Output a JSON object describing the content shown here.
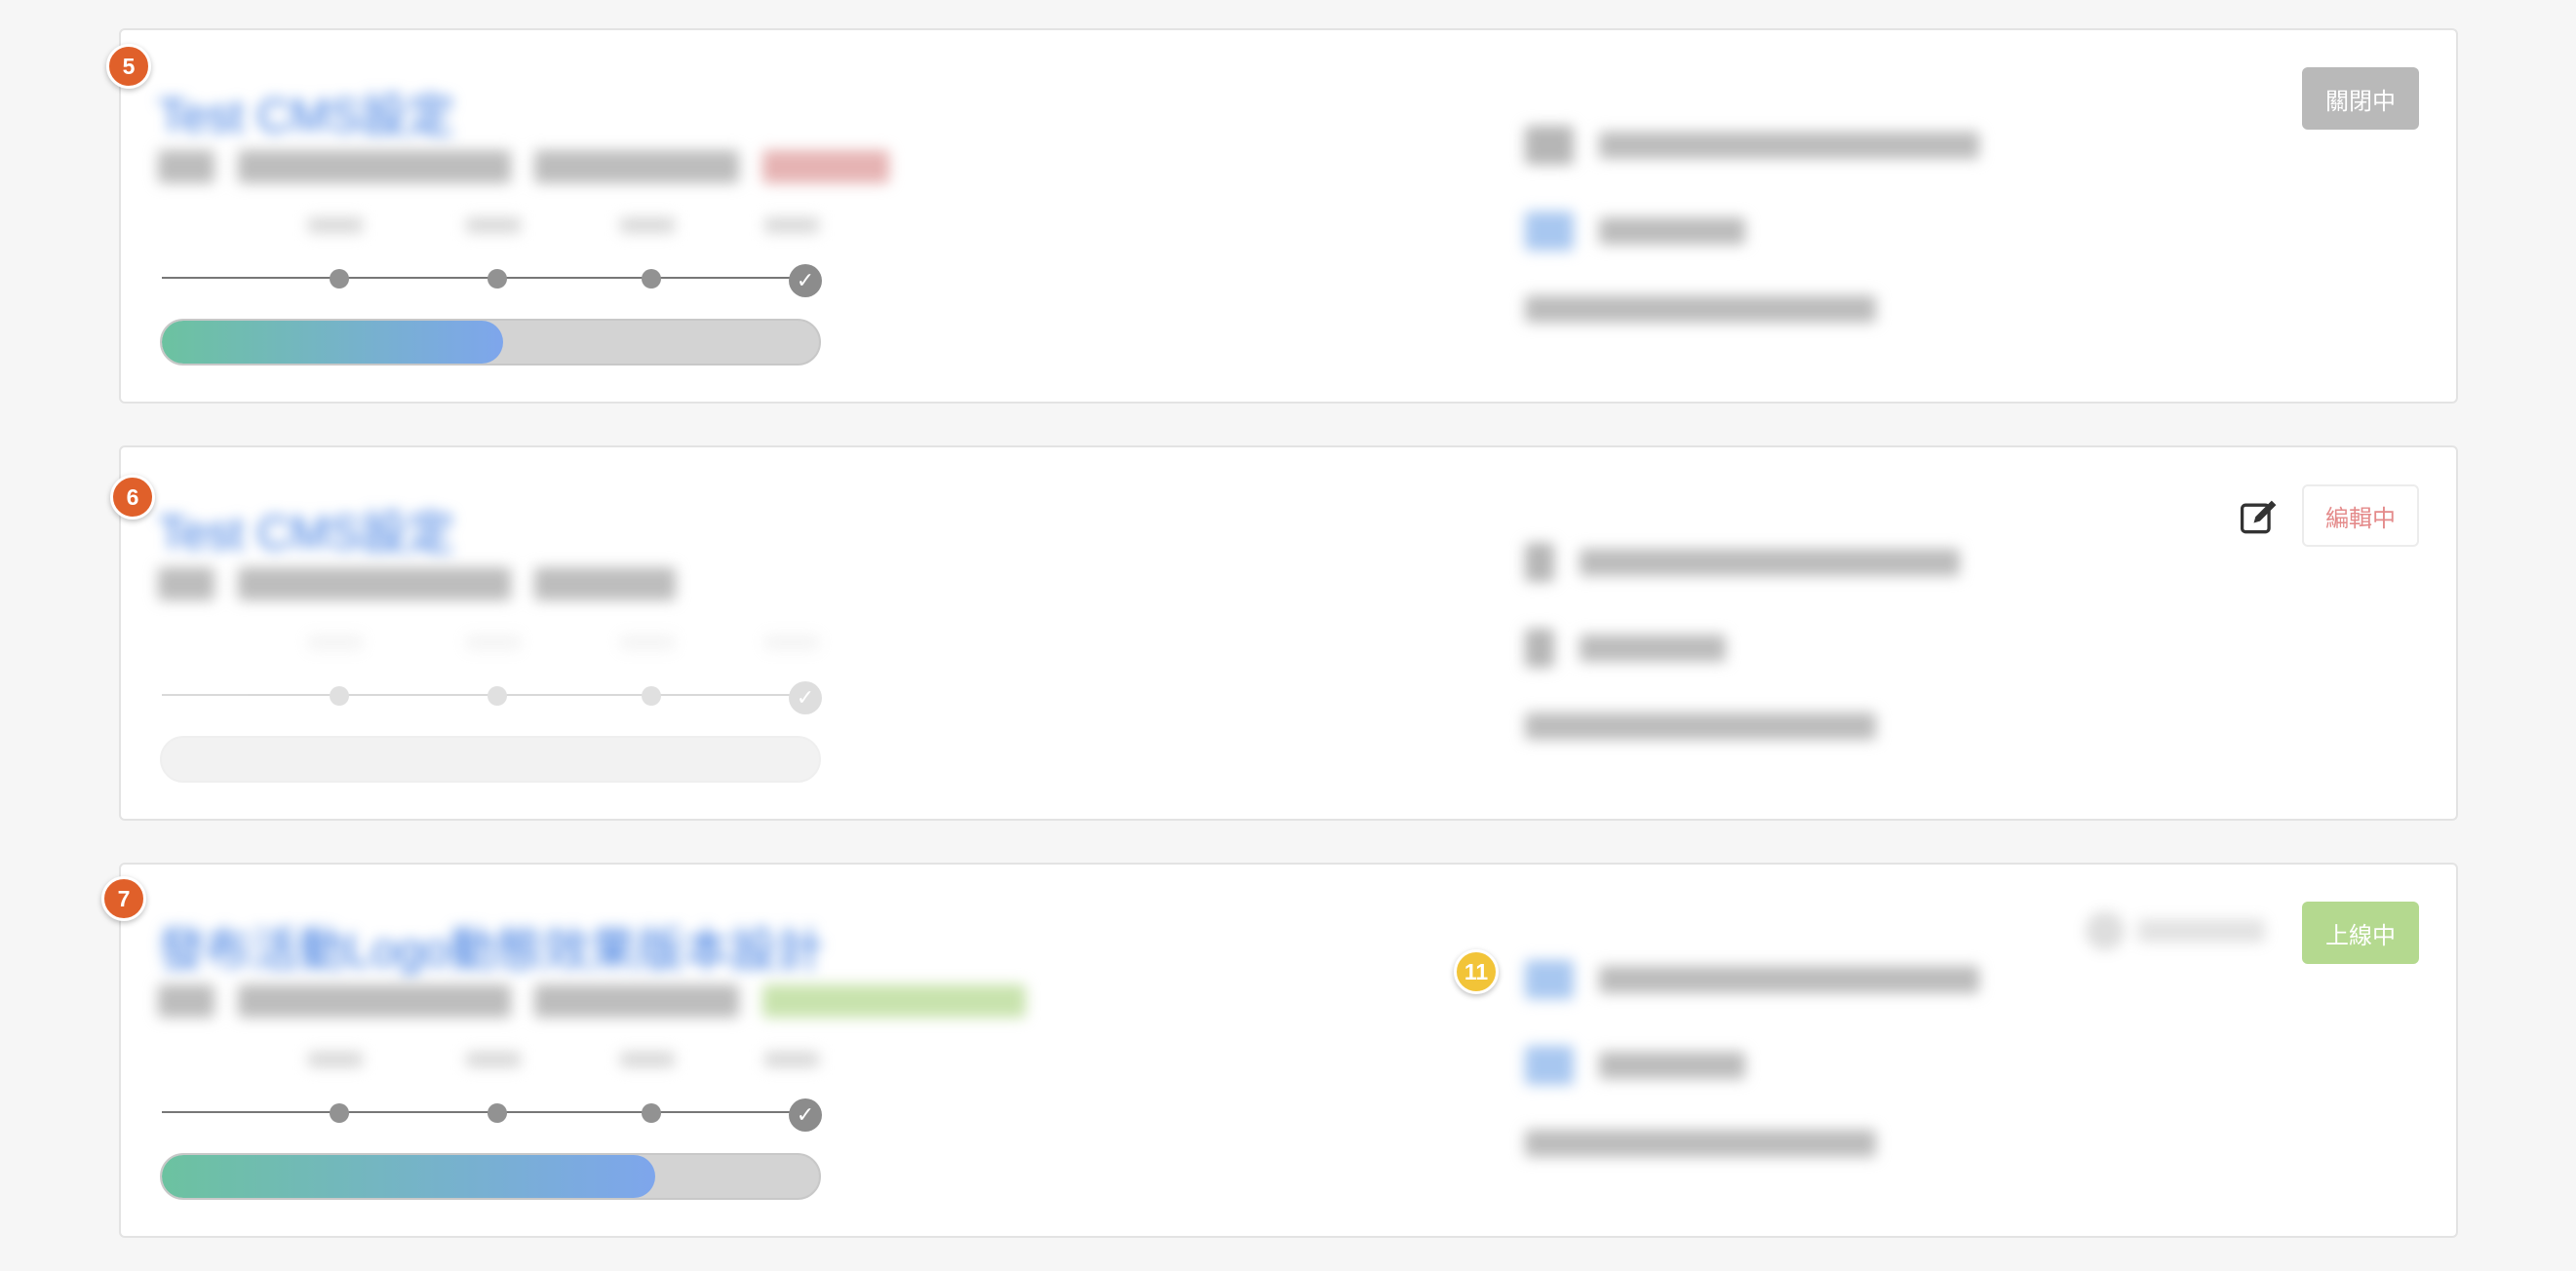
{
  "cards": [
    {
      "index": "5",
      "title": "Test CMS設定",
      "status_label": "關閉中",
      "progress_percent": 52,
      "pre_fill_percent": 23
    },
    {
      "index": "6",
      "title": "Test CMS設定",
      "status_label": "編輯中",
      "progress_percent": 0,
      "pre_fill_percent": 0
    },
    {
      "index": "7",
      "title": "發布活動Logo動態效果版本設計",
      "status_label": "上線中",
      "progress_percent": 75,
      "pre_fill_percent": 19,
      "inline_badge": "11"
    }
  ],
  "colors": {
    "badge_orange": "#e0602a",
    "badge_yellow": "#f2c438",
    "closed": "#b9b9b9",
    "editing_text": "#e48a8a",
    "live": "#b4d98f"
  },
  "icons": {
    "edit": "edit-icon",
    "check": "check-icon"
  }
}
